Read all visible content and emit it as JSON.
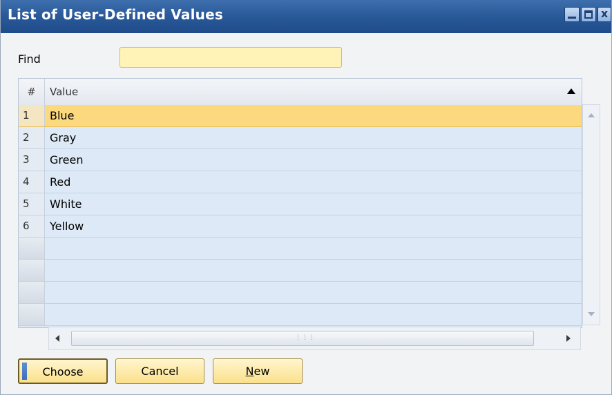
{
  "window": {
    "title": "List of User-Defined Values",
    "close_glyph": "x"
  },
  "find": {
    "label": "Find",
    "value": ""
  },
  "grid": {
    "columns": [
      "#",
      "Value"
    ],
    "sort_icon": "sort-ascending-icon",
    "rows": [
      {
        "num": "1",
        "value": "Blue",
        "selected": true
      },
      {
        "num": "2",
        "value": "Gray",
        "selected": false
      },
      {
        "num": "3",
        "value": "Green",
        "selected": false
      },
      {
        "num": "4",
        "value": "Red",
        "selected": false
      },
      {
        "num": "5",
        "value": "White",
        "selected": false
      },
      {
        "num": "6",
        "value": "Yellow",
        "selected": false
      }
    ],
    "empty_rows": 4
  },
  "buttons": {
    "choose": "Choose",
    "cancel": "Cancel",
    "new_first": "N",
    "new_rest": "ew"
  },
  "colors": {
    "title_bar": "#2a5a9a",
    "selected_row": "#fcd97f",
    "grid_bg": "#dde9f6",
    "button": "#fbe08a"
  }
}
